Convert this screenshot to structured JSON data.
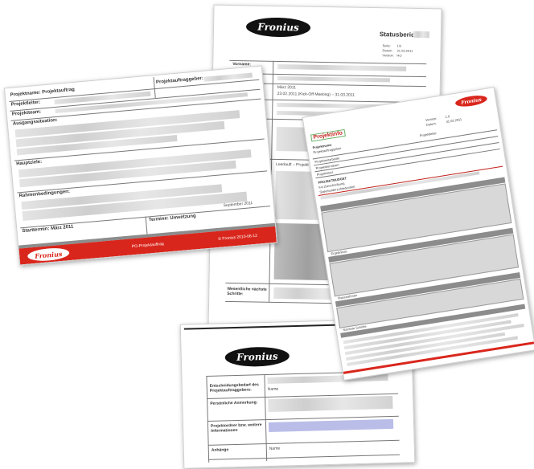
{
  "brand": {
    "name": "Fronius",
    "accent": "#d9261c"
  },
  "status_report": {
    "title": "Statusbericht",
    "meta": [
      "Seite:",
      "1/2",
      "Datum:",
      "31.03.2011",
      "Version:",
      "HO"
    ],
    "rows": {
      "vorname": "Vorname:",
      "zeitraum": "März 2011",
      "zeitraum_detail": "23.02.2011 (Kick-Off Meeting) – 31.03.2011",
      "status_text": "Leerlauft – Projekt liegt",
      "massnahmen": "Wesentliche nächste Schritte:"
    }
  },
  "project_order": {
    "headline": "Projektname: Projektauftrag",
    "fields": {
      "auftraggeber": "Projektauftraggeber:",
      "projektleiter": "Projektleiter:",
      "projektteam": "Projektteam:",
      "ausgangssituation": "Ausgangssituation:",
      "hauptziele": "Hauptziele:",
      "rahmenbedingungen": "Rahmenbedingungen:",
      "starttermin": "Starttermin: März 2011",
      "termine": "Termine: Umsetzung",
      "endtermin": "September 2011"
    },
    "footer": {
      "center": "PO-Projektauftrag",
      "right": "© Fronius 2010-06-12"
    }
  },
  "decision_doc": {
    "rows": [
      "Entscheidungsbedarf des Projektauftraggebers:",
      "Persönliche Anmerkung:",
      "Projektordner bzw. weitere Informationen",
      "Anhänge"
    ],
    "row_values": [
      "Name",
      "Name"
    ]
  },
  "red_doc": {
    "title": "Projektinfo",
    "labels": [
      "Version:",
      "Datum:",
      "Projektname",
      "Projektauftraggeber",
      "Projektleiter",
      "Projektmitarbeiter",
      "Projektkernteam",
      "Projektstart",
      "PROJEKTBUDGET",
      "Kurzbeschreibung",
      "Stakeholderzufriedenheit",
      "Ergebnisse",
      "Massnahmen",
      "Nächste Schritte"
    ],
    "values": [
      "1.0",
      "31.03.2011"
    ]
  }
}
